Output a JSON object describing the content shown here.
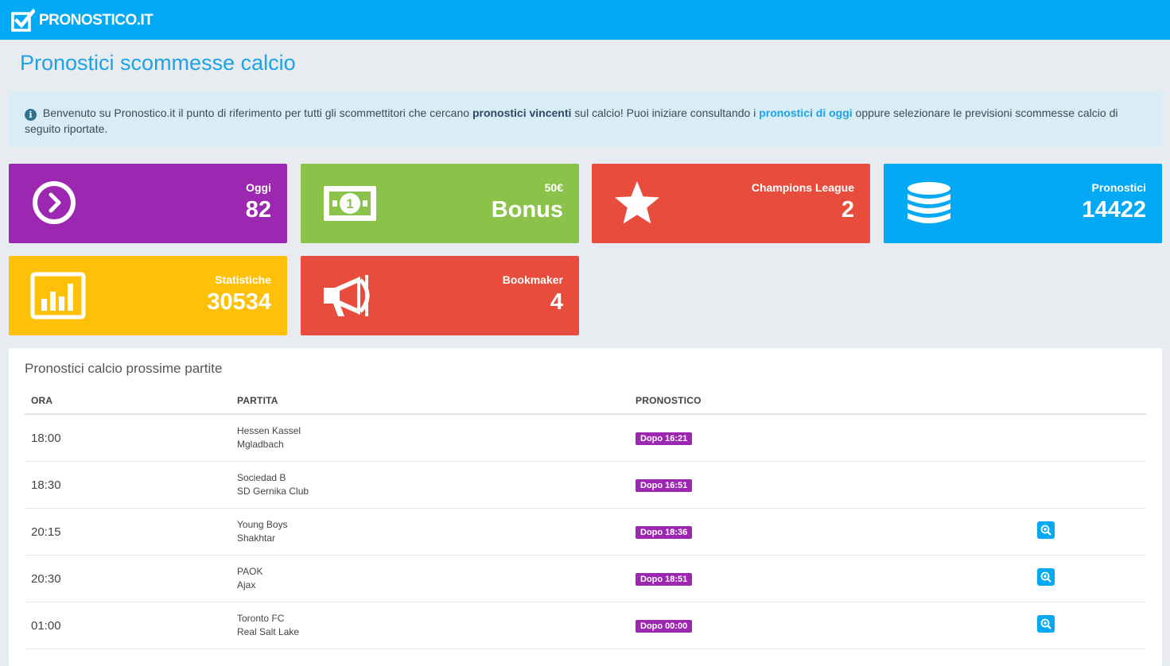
{
  "brand": {
    "name": "PRONOSTICO.IT",
    "primary_color": "#03a9f4"
  },
  "page": {
    "title": "Pronostici scommesse calcio"
  },
  "info": {
    "icon": "info-circle-icon",
    "text_1": "Benvenuto su Pronostico.it il punto di riferimento per tutti gli scommettitori che cercano ",
    "bold_1": "pronostici vincenti",
    "text_2": " sul calcio! Puoi iniziare consultando i ",
    "link_1": "pronostici di oggi",
    "text_3": " oppure selezionare le previsioni scommesse calcio di seguito riportate."
  },
  "tiles": [
    {
      "label": "Oggi",
      "value": "82",
      "color": "#9c27b0",
      "icon": "clock-arrow-icon"
    },
    {
      "label": "50€",
      "value": "Bonus",
      "color": "#8bc34a",
      "icon": "banknote-icon"
    },
    {
      "label": "Champions League",
      "value": "2",
      "color": "#e74c3c",
      "icon": "star-icon"
    },
    {
      "label": "Pronostici",
      "value": "14422",
      "color": "#03a9f4",
      "icon": "database-icon"
    },
    {
      "label": "Statistiche",
      "value": "30534",
      "color": "#ffc107",
      "icon": "bar-chart-icon"
    },
    {
      "label": "Bookmaker",
      "value": "4",
      "color": "#e74c3c",
      "icon": "megaphone-icon"
    }
  ],
  "matches": {
    "title": "Pronostici calcio prossime partite",
    "columns": [
      "ORA",
      "PARTITA",
      "PRONOSTICO"
    ],
    "rows": [
      {
        "time": "18:00",
        "home": "Hessen Kassel",
        "away": "Mgladbach",
        "prediction": "Dopo 16:21",
        "has_zoom": false
      },
      {
        "time": "18:30",
        "home": "Sociedad B",
        "away": "SD Gernika Club",
        "prediction": "Dopo 16:51",
        "has_zoom": false
      },
      {
        "time": "20:15",
        "home": "Young Boys",
        "away": "Shakhtar",
        "prediction": "Dopo 18:36",
        "has_zoom": true
      },
      {
        "time": "20:30",
        "home": "PAOK",
        "away": "Ajax",
        "prediction": "Dopo 18:51",
        "has_zoom": true
      },
      {
        "time": "01:00",
        "home": "Toronto FC",
        "away": "Real Salt Lake",
        "prediction": "Dopo 00:00",
        "has_zoom": true
      }
    ],
    "badge_color": "#9c27b0"
  }
}
